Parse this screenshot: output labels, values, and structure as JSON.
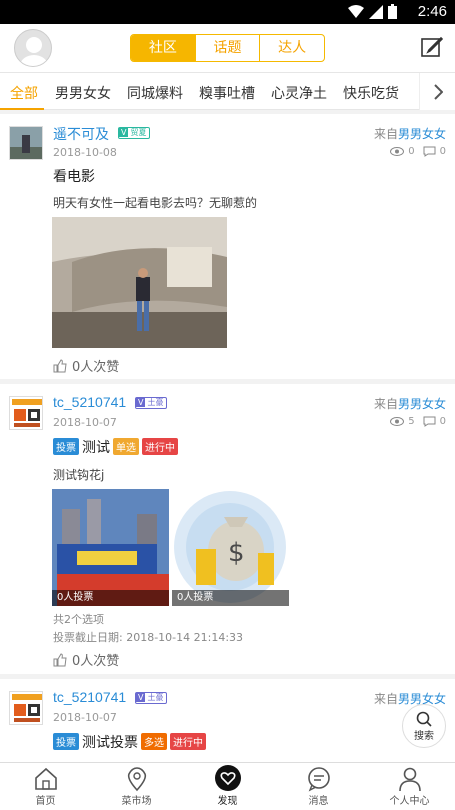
{
  "status_bar": {
    "time": "2:46"
  },
  "header": {
    "segments": [
      {
        "label": "社区",
        "active": true
      },
      {
        "label": "话题",
        "active": false
      },
      {
        "label": "达人",
        "active": false
      }
    ]
  },
  "categories": [
    "全部",
    "男男女女",
    "同城爆料",
    "糗事吐槽",
    "心灵净土",
    "快乐吃货"
  ],
  "posts": [
    {
      "username": "遥不可及",
      "badge_label": "贸夏",
      "from_prefix": "来自",
      "from_category": "男男女女",
      "date": "2018-10-08",
      "views": "0",
      "comments": "0",
      "title": "看电影",
      "body": "明天有女性一起看电影去吗？无聊惹的",
      "likes": "0人次赞"
    },
    {
      "username": "tc_5210741",
      "badge_label": "土豪",
      "from_prefix": "来自",
      "from_category": "男男女女",
      "date": "2018-10-07",
      "views": "5",
      "comments": "0",
      "tag_vote": "投票",
      "vote_title": "测试",
      "tag_type": "单选",
      "tag_status": "进行中",
      "body": "测试钩花j",
      "options": [
        {
          "caption": "0人投票"
        },
        {
          "caption": "0人投票"
        }
      ],
      "option_count": "共2个选项",
      "deadline": "投票截止日期: 2018-10-14 21:14:33",
      "likes": "0人次赞"
    },
    {
      "username": "tc_5210741",
      "badge_label": "土豪",
      "from_prefix": "来自",
      "from_category": "男男女女",
      "date": "2018-10-07",
      "tag_vote": "投票",
      "vote_title": "测试投票",
      "tag_type": "多选",
      "tag_status": "进行中"
    }
  ],
  "fab": {
    "label": "搜索"
  },
  "bottom_nav": [
    {
      "label": "首页",
      "icon": "home-icon"
    },
    {
      "label": "菜市场",
      "icon": "location-pin-icon"
    },
    {
      "label": "发现",
      "icon": "discover-heart-icon",
      "active": true
    },
    {
      "label": "消息",
      "icon": "message-icon"
    },
    {
      "label": "个人中心",
      "icon": "person-icon"
    }
  ]
}
